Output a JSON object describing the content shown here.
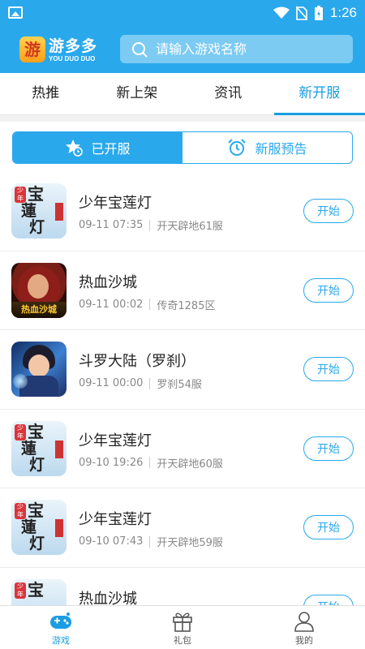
{
  "status_bar": {
    "time": "1:26"
  },
  "header": {
    "logo_badge": "游",
    "logo_title": "游多多",
    "logo_subtitle": "YOU DUO DUO",
    "search_placeholder": "请输入游戏名称"
  },
  "tabs": [
    {
      "label": "热推",
      "active": false
    },
    {
      "label": "新上架",
      "active": false
    },
    {
      "label": "资讯",
      "active": false
    },
    {
      "label": "新开服",
      "active": true
    }
  ],
  "segments": {
    "opened": "已开服",
    "upcoming": "新服预告",
    "active": "opened"
  },
  "servers": [
    {
      "name": "少年宝莲灯",
      "time": "09-11 07:35",
      "server": "开天辟地61服",
      "icon": "lotus-lamp-game-icon",
      "action": "开始"
    },
    {
      "name": "热血沙城",
      "time": "09-11 00:02",
      "server": "传奇1285区",
      "icon": "sand-city-game-icon",
      "action": "开始"
    },
    {
      "name": "斗罗大陆（罗刹）",
      "time": "09-11 00:00",
      "server": "罗刹54服",
      "icon": "douluo-game-icon",
      "action": "开始"
    },
    {
      "name": "少年宝莲灯",
      "time": "09-10 19:26",
      "server": "开天辟地60服",
      "icon": "lotus-lamp-game-icon",
      "action": "开始"
    },
    {
      "name": "少年宝莲灯",
      "time": "09-10 07:43",
      "server": "开天辟地59服",
      "icon": "lotus-lamp-game-icon",
      "action": "开始"
    },
    {
      "name": "热血沙城",
      "time": "",
      "server": "",
      "icon": "sand-city-game-icon",
      "action": "开始"
    }
  ],
  "bottom_nav": [
    {
      "label": "游戏",
      "icon": "gamepad-icon",
      "active": true
    },
    {
      "label": "礼包",
      "icon": "gift-icon",
      "active": false
    },
    {
      "label": "我的",
      "icon": "user-icon",
      "active": false
    }
  ],
  "colors": {
    "primary": "#2aa8ec",
    "accent": "#1a9de2"
  }
}
